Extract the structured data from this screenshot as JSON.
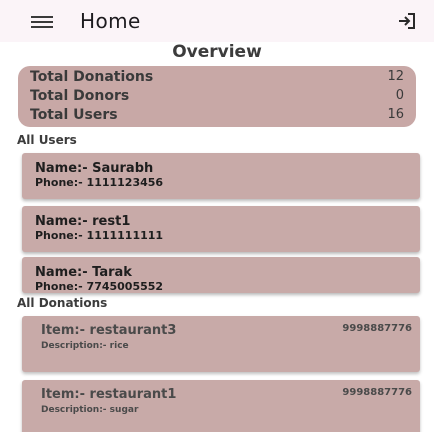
{
  "header": {
    "title": "Home",
    "menu_icon": "hamburger-menu-icon",
    "logout_icon": "logout-icon"
  },
  "overview": {
    "title": "Overview",
    "stats": [
      {
        "label": "Total Donations",
        "value": "12"
      },
      {
        "label": "Total Donors",
        "value": "0"
      },
      {
        "label": "Total Users",
        "value": "16"
      }
    ]
  },
  "users": {
    "section_title": "All Users",
    "items": [
      {
        "name": "Name:- Saurabh",
        "phone": "Phone:- 1111123456"
      },
      {
        "name": "Name:- rest1",
        "phone": "Phone:- 1111111111"
      },
      {
        "name": "Name:- Tarak",
        "phone": "Phone:- 7745005552"
      }
    ]
  },
  "donations": {
    "section_title": "All Donations",
    "items": [
      {
        "item": "Item:- restaurant3",
        "description": "Description:- rice",
        "phone": "9998887776"
      },
      {
        "item": "Item:- restaurant1",
        "description": "Description:- sugar",
        "phone": "9998887776"
      }
    ]
  },
  "colors": {
    "app_bar": "#fbf4f8",
    "card": "#c8a8a6",
    "text": "#1d1b1f"
  }
}
